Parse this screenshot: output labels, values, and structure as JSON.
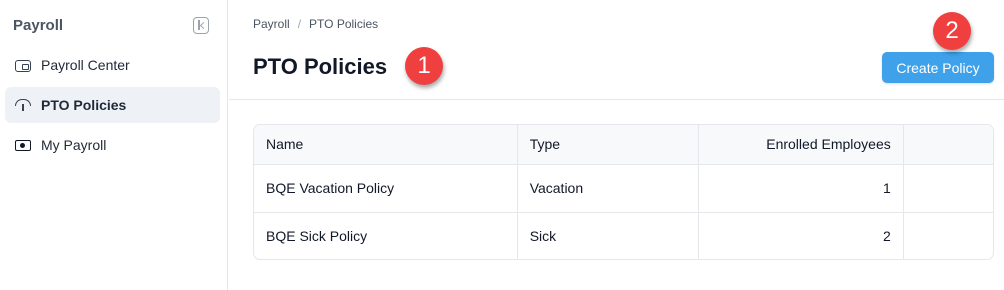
{
  "sidebar": {
    "title": "Payroll",
    "items": [
      {
        "label": "Payroll Center",
        "icon": "wallet-icon",
        "active": false
      },
      {
        "label": "PTO Policies",
        "icon": "umbrella-icon",
        "active": true
      },
      {
        "label": "My Payroll",
        "icon": "money-icon",
        "active": false
      }
    ]
  },
  "breadcrumb": {
    "items": [
      "Payroll",
      "PTO Policies"
    ],
    "separator": "/"
  },
  "header": {
    "title": "PTO Policies",
    "create_label": "Create Policy"
  },
  "annotations": [
    "1",
    "2"
  ],
  "table": {
    "columns": [
      "Name",
      "Type",
      "Enrolled Employees",
      ""
    ],
    "rows": [
      {
        "name": "BQE Vacation Policy",
        "type": "Vacation",
        "enrolled": "1"
      },
      {
        "name": "BQE Sick Policy",
        "type": "Sick",
        "enrolled": "2"
      }
    ]
  },
  "colors": {
    "accent": "#3ea1ea",
    "badge": "#ef3f3f",
    "active_bg": "#eef1f5"
  }
}
